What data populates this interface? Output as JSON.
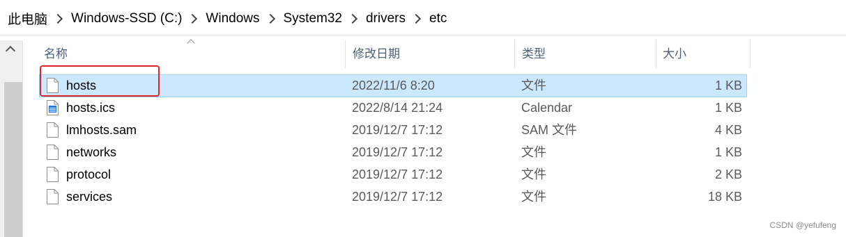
{
  "breadcrumb": [
    "此电脑",
    "Windows-SSD (C:)",
    "Windows",
    "System32",
    "drivers",
    "etc"
  ],
  "columns": {
    "name": "名称",
    "modified": "修改日期",
    "type": "类型",
    "size": "大小"
  },
  "files": [
    {
      "name": "hosts",
      "modified": "2022/11/6 8:20",
      "type": "文件",
      "size": "1 KB",
      "icon": "blank-file-icon",
      "selected": true
    },
    {
      "name": "hosts.ics",
      "modified": "2022/8/14 21:24",
      "type": "Calendar",
      "size": "1 KB",
      "icon": "calendar-file-icon",
      "selected": false
    },
    {
      "name": "lmhosts.sam",
      "modified": "2019/12/7 17:12",
      "type": "SAM 文件",
      "size": "4 KB",
      "icon": "blank-file-icon",
      "selected": false
    },
    {
      "name": "networks",
      "modified": "2019/12/7 17:12",
      "type": "文件",
      "size": "1 KB",
      "icon": "blank-file-icon",
      "selected": false
    },
    {
      "name": "protocol",
      "modified": "2019/12/7 17:12",
      "type": "文件",
      "size": "2 KB",
      "icon": "blank-file-icon",
      "selected": false
    },
    {
      "name": "services",
      "modified": "2019/12/7 17:12",
      "type": "文件",
      "size": "18 KB",
      "icon": "blank-file-icon",
      "selected": false
    }
  ],
  "watermark": "CSDN @yefufeng",
  "colors": {
    "selection": "#cce8ff",
    "highlight_box": "#e0262b",
    "header_text": "#4c607a"
  }
}
